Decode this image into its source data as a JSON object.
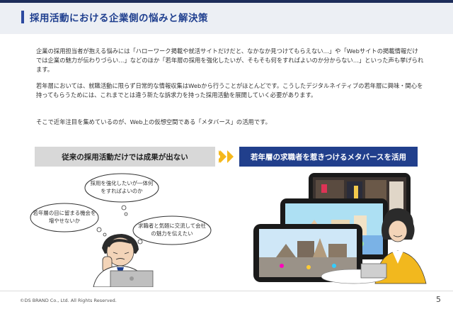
{
  "header": {
    "title": "採用活動における企業側の悩みと解決策"
  },
  "body": {
    "paragraph_1": "企業の採用担当者が抱える悩みには「ハローワーク掲載や就活サイトだけだと、なかなか見つけてもらえない…」や「Webサイトの掲載情報だけでは企業の魅力が伝わりづらい…」などのほか「若年層の採用を強化したいが、そもそも何をすればよいのか分からない…」といった声も挙げられます。",
    "paragraph_2": "若年層においては、就職活動に限らず日常的な情報収集はWebから行うことがほとんどです。こうしたデジタルネイティブの若年層に興味・関心を持ってもらうためには、これまでとは違う新たな訴求力を持った採用活動を展開していく必要があります。",
    "paragraph_3": "そこで近年注目を集めているのが、Web上の仮想空間である「メタバース」の活用です。"
  },
  "comparison": {
    "left_label": "従来の採用活動だけでは成果が出ない",
    "right_label": "若年層の求職者を惹きつけるメタバースを活用",
    "arrow_color": "#f5b81c",
    "left_color": "#d8d8d8",
    "right_color": "#213f8c"
  },
  "illustration_left": {
    "bubble_1": "採用を強化したいが一体何をすればよいのか",
    "bubble_2": "若年層の目に留まる機会を増やせないか",
    "bubble_3": "求職者と気軽に交流して会社の魅力を伝えたい"
  },
  "footer": {
    "copyright": "©DS BRAND Co., Ltd. All Rights Reserved.",
    "page_number": "5"
  }
}
